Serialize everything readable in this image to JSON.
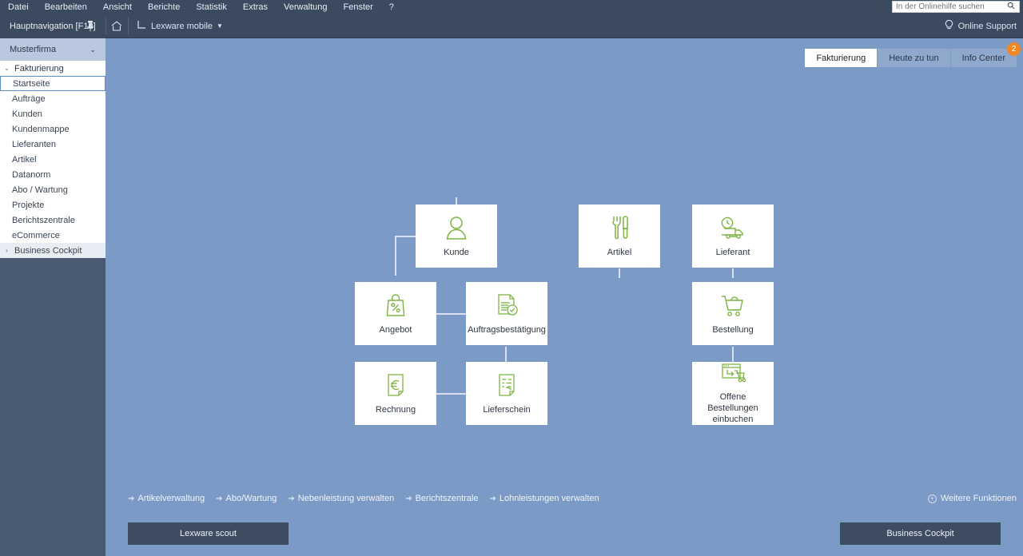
{
  "menubar": {
    "items": [
      {
        "label": "Datei"
      },
      {
        "label": "Bearbeiten"
      },
      {
        "label": "Ansicht"
      },
      {
        "label": "Berichte"
      },
      {
        "label": "Statistik"
      },
      {
        "label": "Extras"
      },
      {
        "label": "Verwaltung"
      },
      {
        "label": "Fenster"
      },
      {
        "label": "?"
      }
    ],
    "search_placeholder": "In der Onlinehilfe suchen",
    "search_value": ""
  },
  "toolbar": {
    "nav_title": "Hauptnavigation [F10]",
    "mobile_label": "Lexware mobile",
    "support_label": "Online Support"
  },
  "sidebar": {
    "company": "Musterfirma",
    "group": "Fakturierung",
    "items": [
      {
        "label": "Startseite",
        "selected": true
      },
      {
        "label": "Aufträge",
        "selected": false
      },
      {
        "label": "Kunden",
        "selected": false
      },
      {
        "label": "Kundenmappe",
        "selected": false
      },
      {
        "label": "Lieferanten",
        "selected": false
      },
      {
        "label": "Artikel",
        "selected": false
      },
      {
        "label": "Datanorm",
        "selected": false
      },
      {
        "label": "Abo / Wartung",
        "selected": false
      },
      {
        "label": "Projekte",
        "selected": false
      },
      {
        "label": "Berichtszentrale",
        "selected": false
      },
      {
        "label": "eCommerce",
        "selected": false
      }
    ],
    "expandable": {
      "label": "Business Cockpit"
    }
  },
  "tabs": [
    {
      "label": "Fakturierung",
      "active": true,
      "badge": ""
    },
    {
      "label": "Heute zu tun",
      "active": false,
      "badge": ""
    },
    {
      "label": "Info Center",
      "active": false,
      "badge": "2"
    }
  ],
  "tiles": [
    {
      "id": "kunde",
      "label": "Kunde",
      "icon": "person-icon"
    },
    {
      "id": "artikel",
      "label": "Artikel",
      "icon": "tools-icon"
    },
    {
      "id": "lieferant",
      "label": "Lieferant",
      "icon": "truck-clock-icon"
    },
    {
      "id": "angebot",
      "label": "Angebot",
      "icon": "bag-percent-icon"
    },
    {
      "id": "auftragsbestaetigung",
      "label": "Auftragsbestätigung",
      "icon": "document-check-icon"
    },
    {
      "id": "bestellung",
      "label": "Bestellung",
      "icon": "shopping-cart-icon"
    },
    {
      "id": "rechnung",
      "label": "Rechnung",
      "icon": "euro-document-icon"
    },
    {
      "id": "lieferschein",
      "label": "Lieferschein",
      "icon": "delivery-note-icon"
    },
    {
      "id": "offene-bestellungen",
      "label": "Offene Bestellungen einbuchen",
      "icon": "receive-order-icon"
    }
  ],
  "footer": {
    "links": [
      {
        "label": "Artikelverwaltung"
      },
      {
        "label": "Abo/Wartung"
      },
      {
        "label": "Nebenleistung verwalten"
      },
      {
        "label": "Berichtszentrale"
      },
      {
        "label": "Lohnleistungen verwalten"
      }
    ],
    "more_functions": "Weitere Funktionen",
    "button_left": "Lexware scout",
    "button_right": "Business Cockpit"
  },
  "colors": {
    "canvas": "#7b9ac6",
    "chrome": "#3b4a5e",
    "accent_green": "#7cb342",
    "badge_orange": "#ef8723",
    "button_navy": "#3d4c60"
  }
}
